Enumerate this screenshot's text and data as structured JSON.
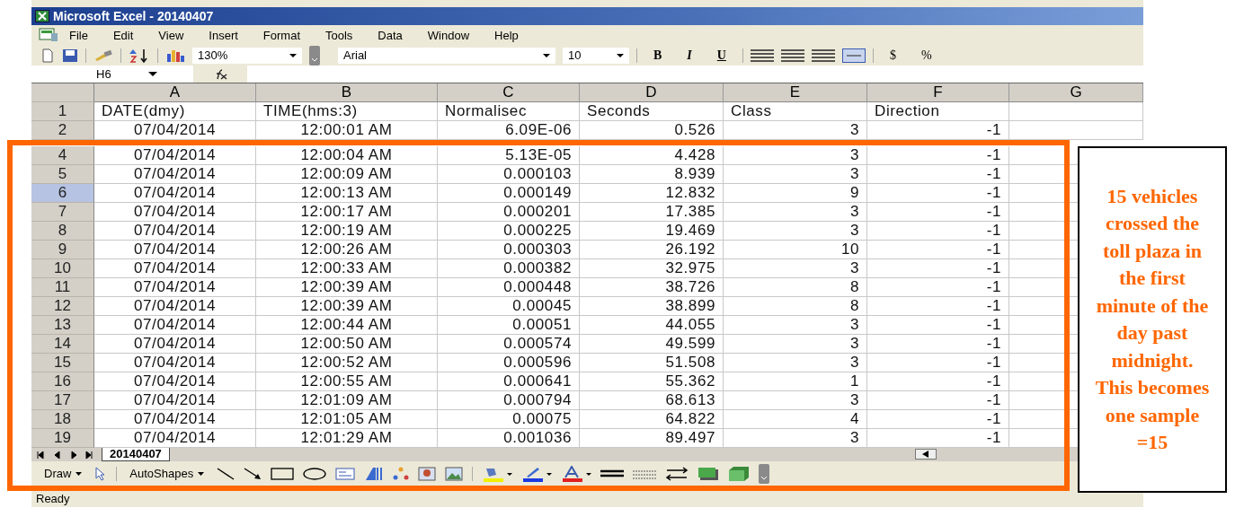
{
  "window": {
    "title": "Microsoft Excel - 20140407"
  },
  "menu": [
    "File",
    "Edit",
    "View",
    "Insert",
    "Format",
    "Tools",
    "Data",
    "Window",
    "Help"
  ],
  "toolbar": {
    "zoom": "130%",
    "font": "Arial",
    "size": "10",
    "bold": "B",
    "italic": "I",
    "underline": "U",
    "currency": "$",
    "percent": "%"
  },
  "formula_bar": {
    "name_box": "H6"
  },
  "columns": [
    "A",
    "B",
    "C",
    "D",
    "E",
    "F",
    "G"
  ],
  "rows": [
    {
      "n": "1",
      "selected": false,
      "cells": [
        "DATE(dmy)",
        "TIME(hms:3)",
        "Normalisec",
        "Seconds",
        "Class",
        "Direction"
      ],
      "kind": "header"
    },
    {
      "n": "2",
      "selected": false,
      "cells": [
        "07/04/2014",
        "12:00:01 AM",
        "6.09E-06",
        "0.526",
        "3",
        "-1"
      ],
      "kind": "data"
    },
    {
      "n": "4",
      "selected": false,
      "cells": [
        "07/04/2014",
        "12:00:04 AM",
        "5.13E-05",
        "4.428",
        "3",
        "-1"
      ],
      "kind": "data"
    },
    {
      "n": "5",
      "selected": false,
      "cells": [
        "07/04/2014",
        "12:00:09 AM",
        "0.000103",
        "8.939",
        "3",
        "-1"
      ],
      "kind": "data"
    },
    {
      "n": "6",
      "selected": true,
      "cells": [
        "07/04/2014",
        "12:00:13 AM",
        "0.000149",
        "12.832",
        "9",
        "-1"
      ],
      "kind": "data"
    },
    {
      "n": "7",
      "selected": false,
      "cells": [
        "07/04/2014",
        "12:00:17 AM",
        "0.000201",
        "17.385",
        "3",
        "-1"
      ],
      "kind": "data"
    },
    {
      "n": "8",
      "selected": false,
      "cells": [
        "07/04/2014",
        "12:00:19 AM",
        "0.000225",
        "19.469",
        "3",
        "-1"
      ],
      "kind": "data"
    },
    {
      "n": "9",
      "selected": false,
      "cells": [
        "07/04/2014",
        "12:00:26 AM",
        "0.000303",
        "26.192",
        "10",
        "-1"
      ],
      "kind": "data"
    },
    {
      "n": "10",
      "selected": false,
      "cells": [
        "07/04/2014",
        "12:00:33 AM",
        "0.000382",
        "32.975",
        "3",
        "-1"
      ],
      "kind": "data"
    },
    {
      "n": "11",
      "selected": false,
      "cells": [
        "07/04/2014",
        "12:00:39 AM",
        "0.000448",
        "38.726",
        "8",
        "-1"
      ],
      "kind": "data"
    },
    {
      "n": "12",
      "selected": false,
      "cells": [
        "07/04/2014",
        "12:00:39 AM",
        "0.00045",
        "38.899",
        "8",
        "-1"
      ],
      "kind": "data"
    },
    {
      "n": "13",
      "selected": false,
      "cells": [
        "07/04/2014",
        "12:00:44 AM",
        "0.00051",
        "44.055",
        "3",
        "-1"
      ],
      "kind": "data"
    },
    {
      "n": "14",
      "selected": false,
      "cells": [
        "07/04/2014",
        "12:00:50 AM",
        "0.000574",
        "49.599",
        "3",
        "-1"
      ],
      "kind": "data"
    },
    {
      "n": "15",
      "selected": false,
      "cells": [
        "07/04/2014",
        "12:00:52 AM",
        "0.000596",
        "51.508",
        "3",
        "-1"
      ],
      "kind": "data"
    },
    {
      "n": "16",
      "selected": false,
      "cells": [
        "07/04/2014",
        "12:00:55 AM",
        "0.000641",
        "55.362",
        "1",
        "-1"
      ],
      "kind": "data"
    },
    {
      "n": "17",
      "selected": false,
      "cells": [
        "07/04/2014",
        "12:01:09 AM",
        "0.000794",
        "68.613",
        "3",
        "-1"
      ],
      "kind": "data"
    },
    {
      "n": "18",
      "selected": false,
      "cells": [
        "07/04/2014",
        "12:01:05 AM",
        "0.00075",
        "64.822",
        "4",
        "-1"
      ],
      "kind": "data"
    },
    {
      "n": "19",
      "selected": false,
      "cells": [
        "07/04/2014",
        "12:01:29 AM",
        "0.001036",
        "89.497",
        "3",
        "-1"
      ],
      "kind": "data"
    }
  ],
  "sheet_tabs": [
    {
      "label": "20140407",
      "selected": true
    }
  ],
  "drawing_toolbar": {
    "draw": "Draw",
    "autoshapes": "AutoShapes"
  },
  "status_bar": "Ready",
  "annotation": "15 vehicles crossed the toll plaza in the first minute of the day past midnight. This becomes one sample =15"
}
